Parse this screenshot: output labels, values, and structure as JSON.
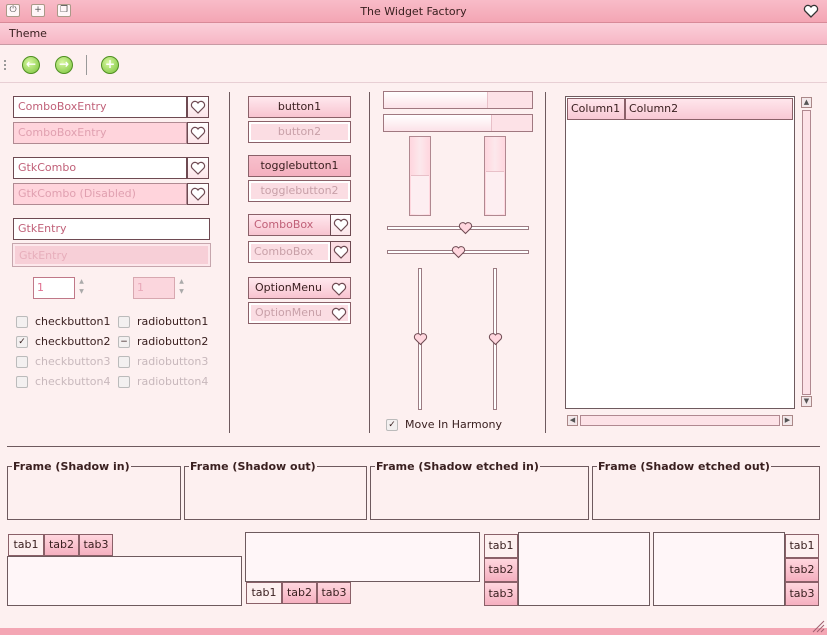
{
  "window": {
    "title": "The Widget Factory",
    "min_label": "⏻",
    "max_label": "+",
    "restore_label": "❐"
  },
  "menu": {
    "theme": "Theme"
  },
  "toolbar": {
    "back_label": "←",
    "forward_label": "→",
    "add_label": "+"
  },
  "col1": {
    "combo_entry": "ComboBoxEntry",
    "combo_entry_dis": "ComboBoxEntry",
    "gtkcombo": "GtkCombo",
    "gtkcombo_dis": "GtkCombo (Disabled)",
    "entry": "GtkEntry",
    "entry_dis": "GtkEntry",
    "spin1": "1",
    "spin2": "1",
    "check1": "checkbutton1",
    "check2": "checkbutton2",
    "check3": "checkbutton3",
    "check4": "checkbutton4",
    "radio1": "radiobutton1",
    "radio2": "radiobutton2",
    "radio3": "radiobutton3",
    "radio4": "radiobutton4",
    "check_mark": "✓",
    "radio_mark": "−"
  },
  "col2": {
    "button1": "button1",
    "button2": "button2",
    "toggle1": "togglebutton1",
    "toggle2": "togglebutton2",
    "combobox1": "ComboBox",
    "combobox2": "ComboBox",
    "option1": "OptionMenu",
    "option2": "OptionMenu"
  },
  "col3": {
    "progress_h": [
      0.7,
      0.73
    ],
    "progress_v": [
      0.5,
      0.55
    ],
    "harmony": "Move In Harmony",
    "harmony_mark": "✓",
    "scale_h": [
      0.55,
      0.5
    ],
    "scale_v": [
      0.5,
      0.5
    ]
  },
  "tree": {
    "columns": [
      "Column1",
      "Column2"
    ]
  },
  "frames": [
    "Frame (Shadow in)",
    "Frame (Shadow out)",
    "Frame (Shadow etched in)",
    "Frame (Shadow etched out)"
  ],
  "tabs": [
    "tab1",
    "tab2",
    "tab3"
  ],
  "scroll": {
    "up": "▲",
    "down": "▼",
    "left": "◀",
    "right": "▶",
    "spin_up": "▲",
    "spin_down": "▼"
  },
  "colors": {
    "accent": "#f4a6b4",
    "heart": "#e8708a"
  }
}
